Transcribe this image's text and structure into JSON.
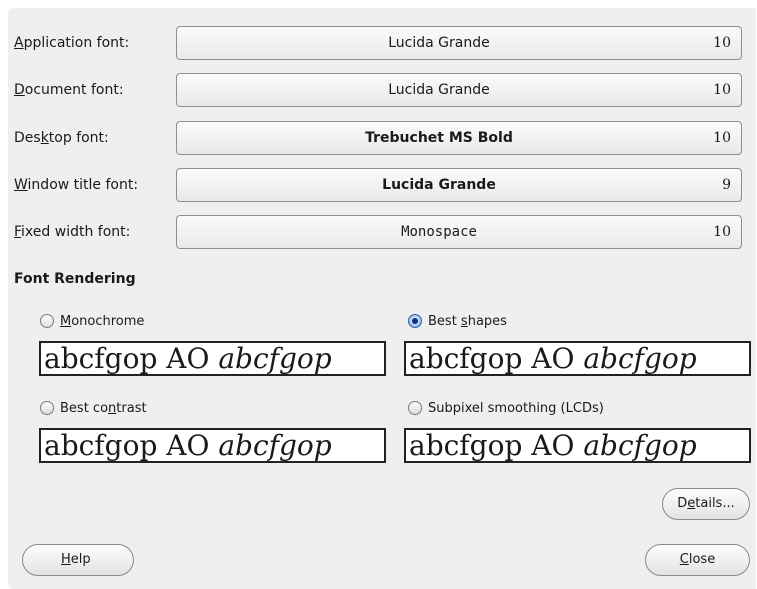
{
  "fonts": [
    {
      "label_pre": "",
      "label_key": "A",
      "label_post": "pplication font:",
      "name": "Lucida Grande",
      "size": "10"
    },
    {
      "label_pre": "",
      "label_key": "D",
      "label_post": "ocument font:",
      "name": "Lucida Grande",
      "size": "10"
    },
    {
      "label_pre": "Des",
      "label_key": "k",
      "label_post": "top font:",
      "name": "Trebuchet MS Bold",
      "size": "10"
    },
    {
      "label_pre": "",
      "label_key": "W",
      "label_post": "indow title font:",
      "name": "Lucida Grande",
      "size": "9"
    },
    {
      "label_pre": "",
      "label_key": "F",
      "label_post": "ixed width font:",
      "name": "Monospace",
      "size": "10"
    }
  ],
  "rendering": {
    "title": "Font Rendering",
    "options": {
      "monochrome": {
        "pre": "",
        "key": "M",
        "post": "onochrome",
        "checked": false
      },
      "best_shapes": {
        "pre": "Best ",
        "key": "s",
        "post": "hapes",
        "checked": true
      },
      "best_contrast": {
        "pre": "Best co",
        "key": "n",
        "post": "trast",
        "checked": false
      },
      "subpixel": {
        "pre": "Subpixel smoothing (LCDs)",
        "key": "",
        "post": "",
        "checked": false
      }
    },
    "sample_regular": "abcfgop AO ",
    "sample_italic": "abcfgop"
  },
  "buttons": {
    "details": {
      "pre": "D",
      "key": "e",
      "post": "tails..."
    },
    "help": {
      "pre": "",
      "key": "H",
      "post": "elp"
    },
    "close": {
      "pre": "",
      "key": "C",
      "post": "lose"
    }
  }
}
